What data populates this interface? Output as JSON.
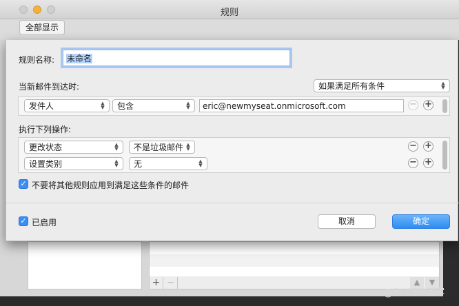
{
  "window": {
    "title": "规则",
    "toolbar": {
      "show_all_label": "全部显示"
    }
  },
  "sheet": {
    "rule_name_label": "规则名称:",
    "rule_name_value": "未命名",
    "trigger_label": "当新邮件到达时:",
    "match_mode": "如果满足所有条件",
    "conditions": [
      {
        "field": "发件人",
        "operator": "包含",
        "value": "eric@newmyseat.onmicrosoft.com"
      }
    ],
    "actions_label": "执行下列操作:",
    "actions": [
      {
        "action": "更改状态",
        "value": "不是垃圾邮件"
      },
      {
        "action": "设置类别",
        "value": "无"
      }
    ],
    "stop_rules_label": "不要将其他规则应用到满足这些条件的邮件",
    "enabled_label": "已启用",
    "cancel_label": "取消",
    "ok_label": "确定",
    "plus_symbol": "+",
    "minus_symbol": "−",
    "checkmark": "✓"
  },
  "background": {
    "add_symbol": "+",
    "remove_symbol": "−",
    "watermark": "@51CTO博客"
  },
  "colors": {
    "accent": "#2d8cf0",
    "focus_ring": "#a8c7f0",
    "traffic_yellow": "#f5b23b"
  },
  "icons": [
    "chevron-updown-icon",
    "plus-circle-icon",
    "minus-circle-icon",
    "checkbox-checked-icon",
    "arrow-up-icon",
    "arrow-down-icon"
  ]
}
